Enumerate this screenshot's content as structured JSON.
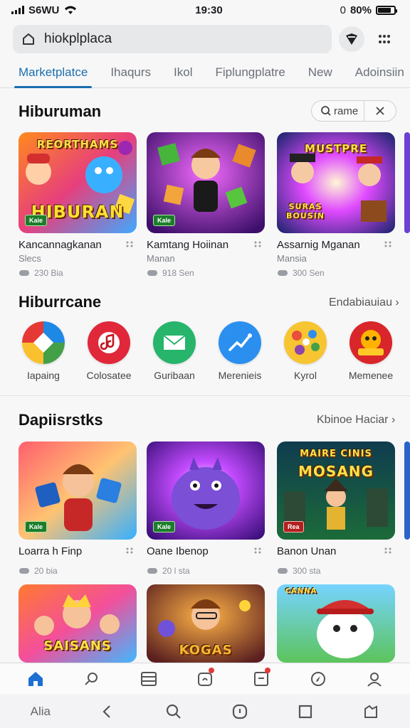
{
  "status": {
    "carrier": "S6WU",
    "time": "19:30",
    "extra": "0",
    "battery": "80%",
    "battery_level": 0.8
  },
  "search": {
    "value": "hiokplplaca"
  },
  "tabs": [
    "Marketplatce",
    "Ihaqurs",
    "Ikol",
    "Fiplungplatre",
    "New",
    "Adoinsiin"
  ],
  "filter": {
    "label": "rame"
  },
  "section1": {
    "title": "Hiburuman",
    "cards": [
      {
        "title": "Kancannagkanan",
        "subtitle": "Slecs",
        "meta": "230 Bia",
        "art": "HIBURAN",
        "top_art": "REORTHAMS",
        "tag": "Kaie"
      },
      {
        "title": "Kamtang Hoiinan",
        "subtitle": "Manan",
        "meta": "918 Sen",
        "art": "",
        "top_art": "",
        "tag": "Kale"
      },
      {
        "title": "Assarnig Mganan",
        "subtitle": "Mansia",
        "meta": "300 Sen",
        "art": "SURAS BOUSIN",
        "top_art": "MUSTPRE",
        "tag": ""
      }
    ]
  },
  "section2": {
    "title": "Hiburrcane",
    "see_all": "Endabiauiau",
    "apps": [
      {
        "label": "Iapaing",
        "colors": [
          "#e53935",
          "#fbc02d",
          "#1e88e5",
          "#43a047"
        ]
      },
      {
        "label": "Colosatee",
        "colors": [
          "#e0283a",
          "#b51622"
        ]
      },
      {
        "label": "Guribaan",
        "colors": [
          "#27b46b",
          "#128a4c"
        ]
      },
      {
        "label": "Merenieis",
        "colors": [
          "#2b8ff0",
          "#1261c7"
        ]
      },
      {
        "label": "Kyrol",
        "colors": [
          "#f7c531",
          "#e84d3d"
        ]
      },
      {
        "label": "Memenee",
        "colors": [
          "#e53935",
          "#ffb300"
        ]
      }
    ]
  },
  "section3": {
    "title": "Dapiisrstks",
    "see_all": "Kbinoe Haciar",
    "cards": [
      {
        "title": "Loarra h Finp",
        "meta": "20 bia",
        "art": "",
        "tag": "Kale"
      },
      {
        "title": "Oane Ibenop",
        "meta": "20 l sta",
        "art": "",
        "tag": "Kale"
      },
      {
        "title": "Banon Unan",
        "meta": "300 sta",
        "art": "MOSANG",
        "top_art": "MAIRE CINIS",
        "tag": "Rea"
      }
    ]
  },
  "section4": {
    "cards": [
      {
        "art": "SAISANS"
      },
      {
        "art": "KOGAS"
      },
      {
        "art": "CANNA"
      }
    ]
  },
  "bottom_nav": [
    "home-icon",
    "search-icon",
    "list-icon",
    "store-icon",
    "bag-icon",
    "compass-icon",
    "profile-icon"
  ],
  "sys_nav": {
    "left_label": "Alia"
  },
  "colors": {
    "accent": "#1b6fae",
    "nav_active": "#1d6fd1"
  }
}
